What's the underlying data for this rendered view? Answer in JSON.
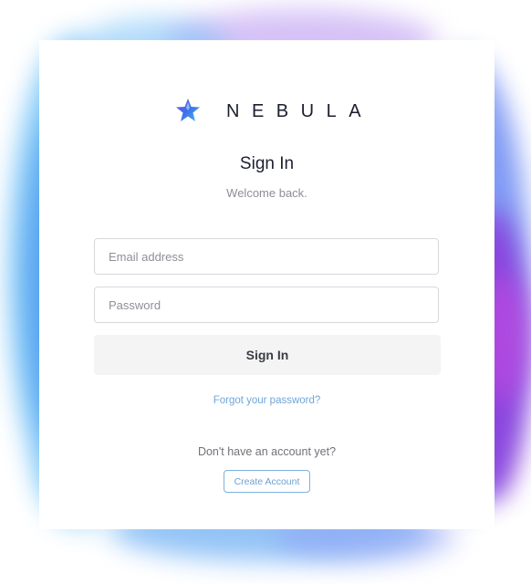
{
  "brand": {
    "name": "NEBULA",
    "logo_icon": "star-logo-icon"
  },
  "signin": {
    "title": "Sign In",
    "subtitle": "Welcome back.",
    "email_placeholder": "Email address",
    "password_placeholder": "Password",
    "button_label": "Sign In",
    "forgot_link": "Forgot your password?"
  },
  "signup": {
    "prompt": "Don't have an account yet?",
    "button_label": "Create Account"
  },
  "colors": {
    "link": "#6fa6d8",
    "button_bg": "#f4f4f5",
    "splash_blue": "#58b6f5",
    "splash_purple": "#8b2fd8"
  }
}
